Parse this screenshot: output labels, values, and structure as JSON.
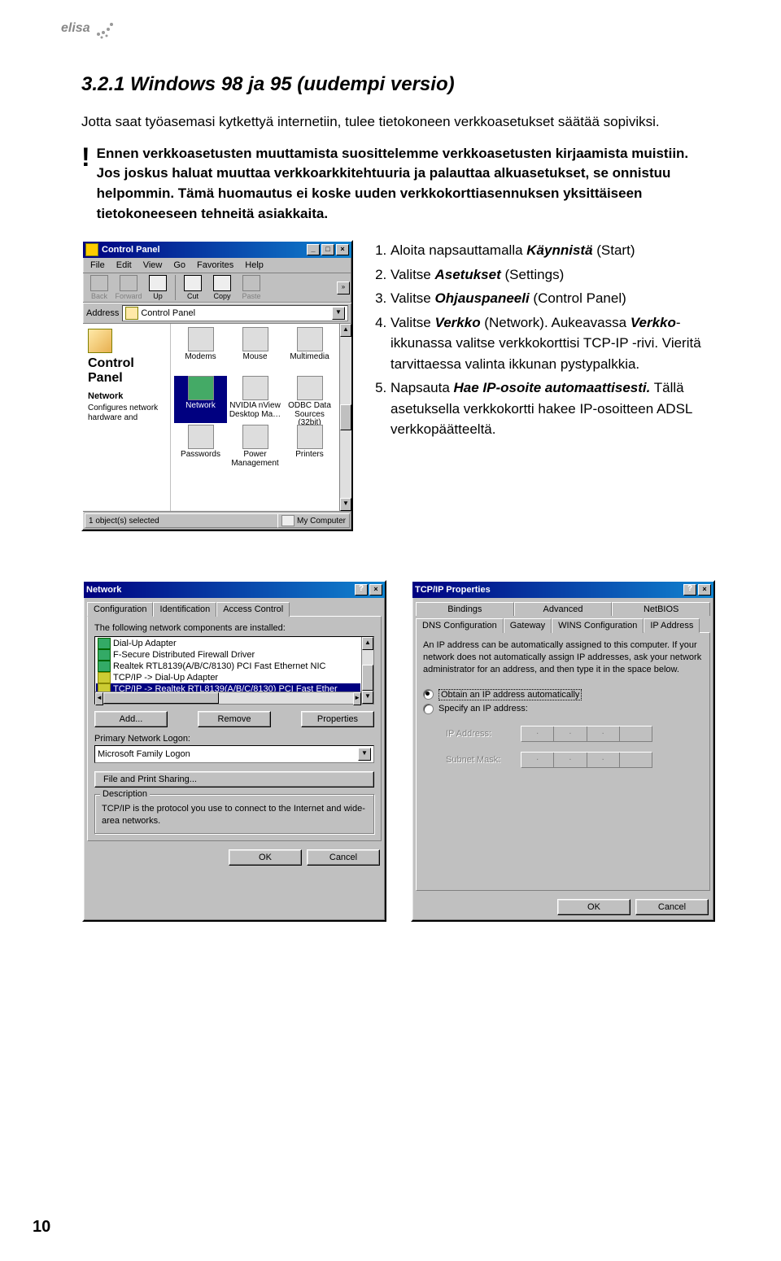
{
  "logo_text": "elisa",
  "section_title": "3.2.1 Windows 98 ja 95 (uudempi versio)",
  "intro_text": "Jotta saat työasemasi kytkettyä internetiin, tulee tietokoneen verkkoasetukset säätää sopiviksi.",
  "warning_mark": "!",
  "warning_text": "Ennen verkkoasetusten muuttamista suosittelemme verkkoasetusten kirjaamista muistiin. Jos joskus haluat muuttaa verkkoarkkitehtuuria ja palauttaa alkuasetukset, se onnistuu helpommin. Tämä huomautus ei koske uuden verkkokorttiasennuksen yksittäiseen tietokoneeseen tehneitä asiakkaita.",
  "control_panel": {
    "title": "Control Panel",
    "menu": [
      "File",
      "Edit",
      "View",
      "Go",
      "Favorites",
      "Help"
    ],
    "toolbar": [
      "Back",
      "Forward",
      "Up",
      "Cut",
      "Copy",
      "Paste"
    ],
    "address_label": "Address",
    "address_value": "Control Panel",
    "left_title": "Control Panel",
    "sel_name": "Network",
    "sel_desc": "Configures network hardware and",
    "icons": [
      "Modems",
      "Mouse",
      "Multimedia",
      "Network",
      "NVIDIA nView Desktop Ma…",
      "ODBC Data Sources (32bit)",
      "Passwords",
      "Power Management",
      "Printers"
    ],
    "status_left": "1 object(s) selected",
    "status_right": "My Computer"
  },
  "steps": {
    "s1_a": "Aloita napsauttamalla ",
    "s1_b": "Käynnistä",
    "s1_c": " (Start)",
    "s2_a": "Valitse ",
    "s2_b": "Asetukset",
    "s2_c": " (Settings)",
    "s3_a": "Valitse ",
    "s3_b": "Ohjauspaneeli",
    "s3_c": " (Control Panel)",
    "s4_a": "Valitse ",
    "s4_b": "Verkko",
    "s4_c": " (Network). Aukeavassa ",
    "s4_d": "Verkko",
    "s4_e": "-ikkunassa valitse verkkokorttisi TCP-IP -rivi. Vieritä tarvittaessa valinta ikkunan pystypalkkia.",
    "s5_a": "Napsauta ",
    "s5_b": "Hae IP-osoite automaattisesti.",
    "s5_c": " Tällä asetuksella verkkokortti hakee IP-osoitteen ADSL verkkopäätteeltä."
  },
  "network_dialog": {
    "title": "Network",
    "tabs": [
      "Configuration",
      "Identification",
      "Access Control"
    ],
    "list_label": "The following network components are installed:",
    "items": [
      "Dial-Up Adapter",
      "F-Secure Distributed Firewall Driver",
      "Realtek RTL8139(A/B/C/8130) PCI Fast Ethernet NIC",
      "TCP/IP -> Dial-Up Adapter",
      "TCP/IP -> Realtek RTL8139(A/B/C/8130) PCI Fast Ether"
    ],
    "add_btn": "Add...",
    "remove_btn": "Remove",
    "props_btn": "Properties",
    "logon_label": "Primary Network Logon:",
    "logon_value": "Microsoft Family Logon",
    "fp_btn": "File and Print Sharing...",
    "desc_legend": "Description",
    "desc_text": "TCP/IP is the protocol you use to connect to the Internet and wide-area networks.",
    "ok": "OK",
    "cancel": "Cancel"
  },
  "tcpip_dialog": {
    "title": "TCP/IP Properties",
    "tabs_row1": [
      "Bindings",
      "Advanced",
      "NetBIOS"
    ],
    "tabs_row2": [
      "DNS Configuration",
      "Gateway",
      "WINS Configuration",
      "IP Address"
    ],
    "info_text": "An IP address can be automatically assigned to this computer. If your network does not automatically assign IP addresses, ask your network administrator for an address, and then type it in the space below.",
    "radio_auto": "Obtain an IP address automatically",
    "radio_specify": "Specify an IP address:",
    "ip_label": "IP Address:",
    "mask_label": "Subnet Mask:",
    "ok": "OK",
    "cancel": "Cancel"
  },
  "page_number": "10"
}
